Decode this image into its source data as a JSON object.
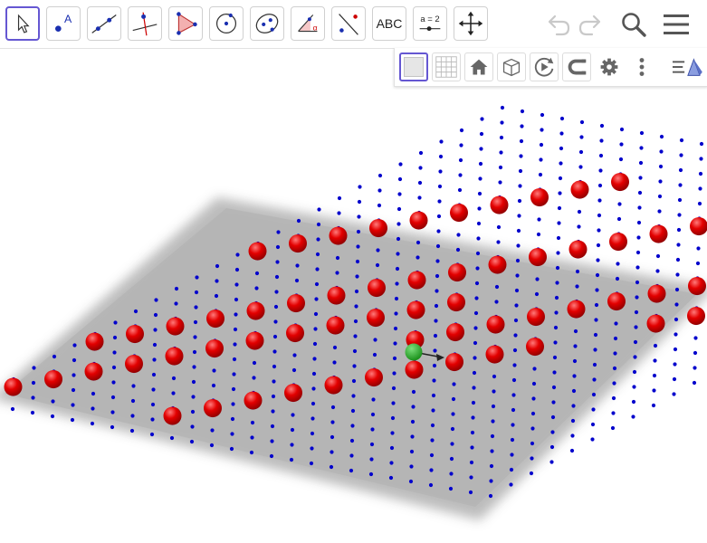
{
  "toolbar": {
    "tools": [
      {
        "name": "move-tool",
        "icon": "cursor-arrow-icon",
        "active": true
      },
      {
        "name": "point-tool",
        "icon": "point-label-icon",
        "label": "A"
      },
      {
        "name": "line-tool",
        "icon": "line-through-points-icon"
      },
      {
        "name": "perpendicular-line-tool",
        "icon": "perpendicular-line-icon"
      },
      {
        "name": "polygon-tool",
        "icon": "triangle-polygon-icon"
      },
      {
        "name": "circle-tool",
        "icon": "circle-center-point-icon"
      },
      {
        "name": "conic-tool",
        "icon": "ellipse-icon"
      },
      {
        "name": "angle-tool",
        "icon": "angle-icon",
        "label": "α"
      },
      {
        "name": "reflect-tool",
        "icon": "reflect-about-line-icon"
      },
      {
        "name": "text-tool",
        "icon": "text-abc-icon",
        "label": "ABC"
      },
      {
        "name": "slider-tool",
        "icon": "slider-icon",
        "label": "a = 2"
      },
      {
        "name": "move-graphics-tool",
        "icon": "move-arrows-icon"
      }
    ],
    "right": [
      {
        "name": "undo-button",
        "icon": "undo-icon",
        "enabled": false
      },
      {
        "name": "redo-button",
        "icon": "redo-icon",
        "enabled": false
      },
      {
        "name": "search-button",
        "icon": "search-icon"
      },
      {
        "name": "menu-button",
        "icon": "hamburger-menu-icon"
      }
    ]
  },
  "graphics_toolbar": {
    "buttons": [
      {
        "name": "plane-toggle",
        "icon": "plane-square-icon",
        "active": true
      },
      {
        "name": "grid-toggle",
        "icon": "grid-icon"
      },
      {
        "name": "standard-view-button",
        "icon": "home-icon"
      },
      {
        "name": "view-direction-button",
        "icon": "cube-icon"
      },
      {
        "name": "rotate-view-button",
        "icon": "rotate-play-icon"
      },
      {
        "name": "magnet-toggle",
        "icon": "magnet-icon"
      },
      {
        "name": "settings-button",
        "icon": "gear-icon"
      },
      {
        "name": "more-options-button",
        "icon": "vertical-dots-icon"
      },
      {
        "name": "style-bar-toggle",
        "icon": "style-bar-prism-icon"
      }
    ]
  },
  "colors": {
    "accent": "#6557d2",
    "sphere": "#e30000",
    "lattice_dot": "#0000cc",
    "center_point": "#1fa01f",
    "plane": "#b9b9b9"
  },
  "scene": {
    "lattice_rows": 27,
    "lattice_cols": 27,
    "red_spheres": [
      [
        1,
        1
      ],
      [
        2,
        2
      ],
      [
        3,
        3
      ],
      [
        4,
        4
      ],
      [
        5,
        5
      ],
      [
        6,
        6
      ],
      [
        7,
        7
      ],
      [
        8,
        8
      ],
      [
        9,
        9
      ],
      [
        10,
        10
      ],
      [
        11,
        11
      ],
      [
        12,
        12
      ],
      [
        5,
        1
      ],
      [
        6,
        2
      ],
      [
        7,
        3
      ],
      [
        8,
        4
      ],
      [
        9,
        5
      ],
      [
        10,
        6
      ],
      [
        11,
        7
      ],
      [
        12,
        8
      ],
      [
        13,
        9
      ],
      [
        14,
        10
      ],
      [
        15,
        11
      ],
      [
        16,
        12
      ],
      [
        1,
        9
      ],
      [
        2,
        10
      ],
      [
        3,
        11
      ],
      [
        4,
        12
      ],
      [
        5,
        13
      ],
      [
        6,
        14
      ],
      [
        7,
        15
      ],
      [
        8,
        16
      ],
      [
        9,
        17
      ],
      [
        10,
        18
      ],
      [
        13,
        1
      ],
      [
        14,
        2
      ],
      [
        15,
        3
      ],
      [
        16,
        4
      ],
      [
        17,
        5
      ],
      [
        18,
        6
      ],
      [
        19,
        7
      ],
      [
        20,
        8
      ],
      [
        21,
        9
      ],
      [
        22,
        10
      ],
      [
        9,
        13
      ],
      [
        10,
        14
      ],
      [
        11,
        15
      ],
      [
        12,
        16
      ],
      [
        13,
        17
      ],
      [
        14,
        18
      ],
      [
        15,
        19
      ],
      [
        16,
        20
      ],
      [
        17,
        13
      ],
      [
        18,
        14
      ],
      [
        19,
        15
      ],
      [
        20,
        16
      ],
      [
        21,
        17
      ],
      [
        22,
        18
      ],
      [
        13,
        21
      ],
      [
        14,
        22
      ],
      [
        15,
        23
      ],
      [
        16,
        24
      ],
      [
        17,
        25
      ],
      [
        21,
        21
      ],
      [
        22,
        22
      ],
      [
        23,
        23
      ],
      [
        24,
        24
      ],
      [
        25,
        25
      ],
      [
        19,
        20
      ]
    ]
  }
}
